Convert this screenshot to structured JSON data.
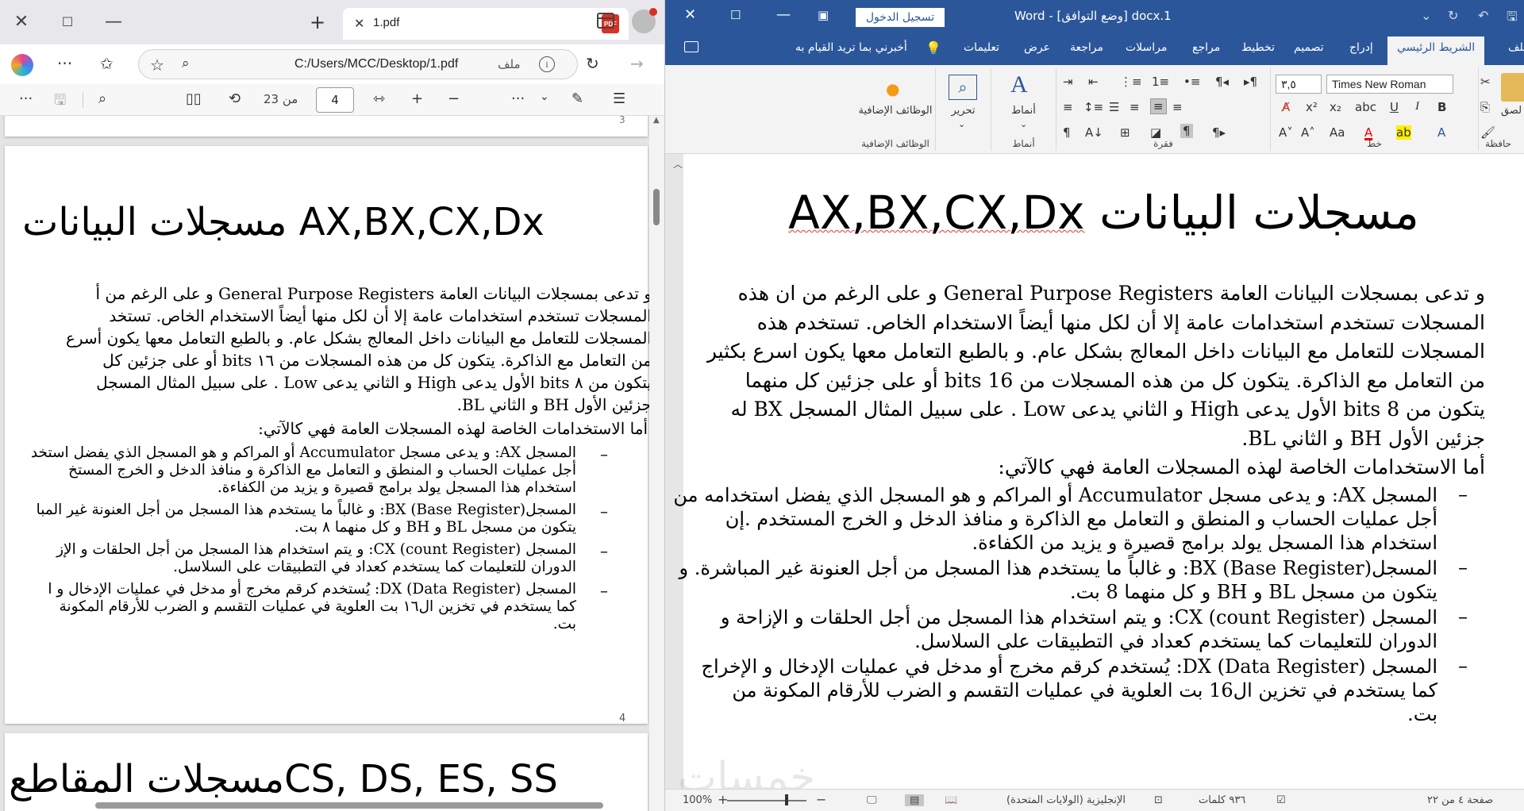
{
  "edge": {
    "tab_title": "1.pdf",
    "tab_pdf_badge": "PDF",
    "url": "C:/Users/MCC/Desktop/1.pdf",
    "file_label": "ملف",
    "info_label": "i",
    "page_current": "4",
    "page_of": "من 23",
    "icons": [
      "close-icon",
      "restore-icon",
      "minimize-icon",
      "new-tab-icon",
      "tab-close-icon",
      "pdf-icon",
      "tab-actions-icon",
      "profile-icon",
      "copilot-icon",
      "more-icon",
      "favorites-icon",
      "star-icon",
      "zoom-icon",
      "refresh-icon",
      "forward-icon",
      "toc-icon",
      "draw-icon",
      "save-icon",
      "search-icon",
      "page-view-icon",
      "rotate-icon",
      "fit-width-icon",
      "zoom-in-icon",
      "zoom-out-icon"
    ]
  },
  "pdf": {
    "prev_page_num": "3",
    "title": "مسجلات البيانات AX,BX,CX,Dx",
    "paragraph_lines": [
      "و تدعى بمسجلات البيانات العامة General Purpose Registers و على الرغم من أ",
      "المسجلات تستخدم استخدامات عامة إلا أن لكل منها أيضاً الاستخدام الخاص. تستخد",
      "المسجلات للتعامل مع البيانات داخل المعالج بشكل عام. و بالطبع التعامل معها يكون أسرع",
      "من التعامل مع الذاكرة. يتكون كل من هذه المسجلات من ١٦ bits أو على جزئين كل",
      "يتكون من ٨ bits الأول يدعى High و الثاني يدعى Low . على سبيل المثال المسجل",
      "جزئين الأول BH و الثاني BL."
    ],
    "uses_heading": "أما الاستخدامات الخاصة لهذه المسجلات العامة فهي كالآتي:",
    "bullets": [
      [
        "المسجل AX: و يدعى مسجل Accumulator أو المراكم و هو المسجل الذي يفضل استخد",
        "أجل عمليات الحساب و المنطق و التعامل مع الذاكرة و منافذ الدخل و الخرج المستخ",
        "استخدام هذا المسجل يولد برامج قصيرة و يزيد من الكفاءة."
      ],
      [
        "المسجلBX (Base Register): و غالباً ما يستخدم هذا المسجل من أجل العنونة غير المبا",
        "يتكون من مسجل BL و BH و كل منهما ٨ بت."
      ],
      [
        "المسجل CX (count Register): و يتم استخدام هذا المسجل من أجل الحلقات و الإز",
        "الدوران للتعليمات كما يستخدم كعداد في التطبيقات على السلاسل."
      ],
      [
        "المسجل DX (Data Register): يُستخدم كرقم مخرج أو مدخل في عمليات الإدخال و ا",
        "كما يستخدم في تخزين ال١٦ بت العلوية في عمليات التقسم و الضرب للأرقام المكونة",
        "بت."
      ]
    ],
    "bullet_dash": "–",
    "page_number": "4",
    "next_title": "مسجلات المقاطعCS, DS, ES, SS"
  },
  "word": {
    "signin": "تسجيل الدخول",
    "doc_title": "docx.1 [وضع التوافق] - Word",
    "tabs": [
      "ملف",
      "الشريط الرئيسي",
      "إدراج",
      "تصميم",
      "تخطيط",
      "مراجع",
      "مراسلات",
      "مراجعة",
      "عرض",
      "تعليمات"
    ],
    "active_tab": "الشريط الرئيسي",
    "tell_me": "أخبرني بما تريد القيام به",
    "font_name": "Times New Roman",
    "font_size": "٣,٥",
    "groups": {
      "clipboard": "حافظة",
      "font": "خط",
      "paragraph": "فقرة",
      "styles": "أنماط",
      "addins": "الوظائف الإضافية"
    },
    "styles_label": "أنماط",
    "edit_label": "تحرير",
    "addins_label": "الوظائف الإضافية",
    "paste_label": "لصق",
    "title_arabic": "مسجلات البيانات",
    "title_latin": "AX,BX,CX,Dx",
    "paragraph_lines": [
      "و تدعى بمسجلات البيانات العامة General Purpose Registers و على الرغم من ان هذه",
      "المسجلات تستخدم استخدامات عامة إلا أن لكل منها أيضاً الاستخدام الخاص. تستخدم هذه",
      "المسجلات للتعامل مع البيانات داخل المعالج بشكل عام. و بالطبع التعامل معها يكون اسرع بكثير",
      "من التعامل مع الذاكرة. يتكون كل من هذه المسجلات من 16 bits أو على جزئين كل منهما",
      "يتكون من 8 bits الأول يدعى High و الثاني يدعى Low . على سبيل المثال المسجل BX له",
      "جزئين الأول BH و الثاني BL."
    ],
    "uses_heading": "أما الاستخدامات الخاصة لهذه المسجلات العامة فهي كالآتي:",
    "bullets": [
      [
        "المسجل AX: و يدعى مسجل Accumulator أو المراكم و هو المسجل الذي يفضل استخدامه من",
        "أجل عمليات الحساب و المنطق و التعامل مع الذاكرة و منافذ الدخل و الخرج المستخدم .إن",
        "استخدام هذا المسجل يولد برامج قصيرة و يزيد من الكفاءة."
      ],
      [
        "المسجلBX (Base Register): و غالباً ما يستخدم هذا المسجل من أجل العنونة غير المباشرة. و",
        "يتكون من مسجل BL و BH و كل منهما 8 بت."
      ],
      [
        "المسجل CX (count Register): و يتم استخدام هذا المسجل من أجل الحلقات و الإزاحة و",
        "الدوران للتعليمات كما يستخدم كعداد في التطبيقات على السلاسل."
      ],
      [
        "المسجل DX (Data Register): يُستخدم كرقم مخرج أو مدخل في عمليات الإدخال و الإخراج",
        "كما يستخدم في تخزين ال16 بت العلوية في عمليات التقسم و الضرب للأرقام المكونة من",
        "بت."
      ]
    ],
    "bullet_dash": "–",
    "status": {
      "page": "صفحة ٤ من ٢٢",
      "words": "٩٣٦ كلمات",
      "language": "الإنجليزية (الولايات المتحدة)",
      "zoom": "100%"
    },
    "watermark": "خمسات"
  }
}
